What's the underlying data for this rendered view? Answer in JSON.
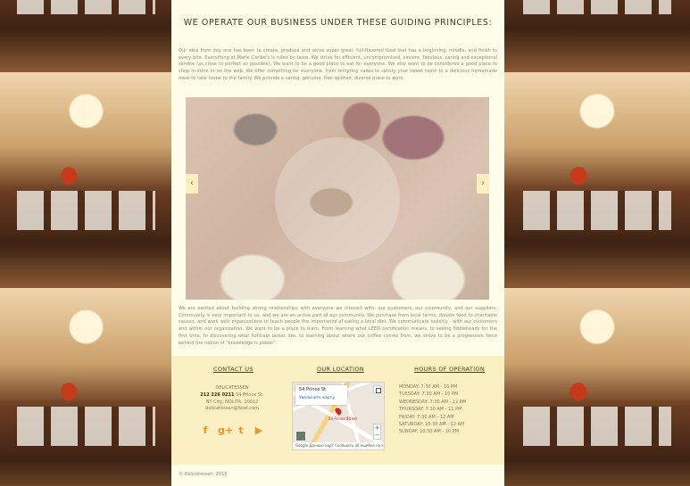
{
  "main": {
    "heading": "We operate our business under these guiding principles:",
    "paragraph1": "Our idea from day one has been to create, produce and serve super great, full-flavored food that has a beginning, middle, and finish to every bite. Everything at Marie Caribo's is ruled by taste. We strive for efficient, uncompromised, sincere, fabulous, caring and exceptional service (as close to perfect as possible). We want to be a good place to eat for everyone. We also want to be considered a good place to shop in-store or on the web. We offer something for everyone, from tempting cakes to satisfy your sweet tooth to a delicious homemade meal to take home to the family. We provide a caring, genuine, free-spirited, diverse place to work.",
    "paragraph2": "We are excited about building strong relationships with everyone we interact with: our customers, our community, and our suppliers. Community is very important to us, and we are an active part of our community. We purchase from local farms, donate food to charitable causes, and work with organizations to teach people the importance of eating a local diet. We communicate lavishly - with our customers and within our organization. We want to be a place to learn. From learning what LEED certification means, to seeing fiddleheads for the first time, to discovering what kohlrabi tastes like, to learning about where our coffee comes from, we strive to be a progressive force behind the notion of \"knowledge is power\".",
    "slider": {
      "prev_icon": "chevron-left-icon",
      "next_icon": "chevron-right-icon",
      "prev_glyph": "‹",
      "next_glyph": "›"
    }
  },
  "footer": {
    "contact": {
      "title": "Contact us",
      "name": "DELICATESSEN",
      "phone": "212 226 0211",
      "street": "54 Prince St.",
      "city": "NY City, NOLITA, 10012",
      "email": "delicatessen@food.com",
      "socials": [
        {
          "icon": "facebook-icon",
          "glyph": "f"
        },
        {
          "icon": "google-plus-icon",
          "glyph": "g+"
        },
        {
          "icon": "twitter-icon",
          "glyph": "t"
        },
        {
          "icon": "youtube-icon",
          "glyph": "▶"
        }
      ]
    },
    "location": {
      "title": "Our location",
      "map_address": "54 Prince St",
      "map_link": "Увеличить карту",
      "map_pin_label": "54 Prince Street",
      "map_footer": "Google  Данные карт  Сообщить об ошибке на карте"
    },
    "hours": {
      "title": "Hours of operation",
      "lines": [
        "MONDAY: 7:30 am - 10 pm",
        "TUESDAY: 7:30 am - 10 pm",
        "WEDNESDAY: 7:30 am - 11 pm",
        "THURSDAY: 7:30 am - 11 pm",
        "FRIDAY: 7:30 am - 12 am",
        "SATURDAY: 10:30 am - 12 am",
        "SUNDAY: 10:30 am - 10 pm"
      ]
    },
    "copyright": "© Delicatessen, 2015"
  }
}
